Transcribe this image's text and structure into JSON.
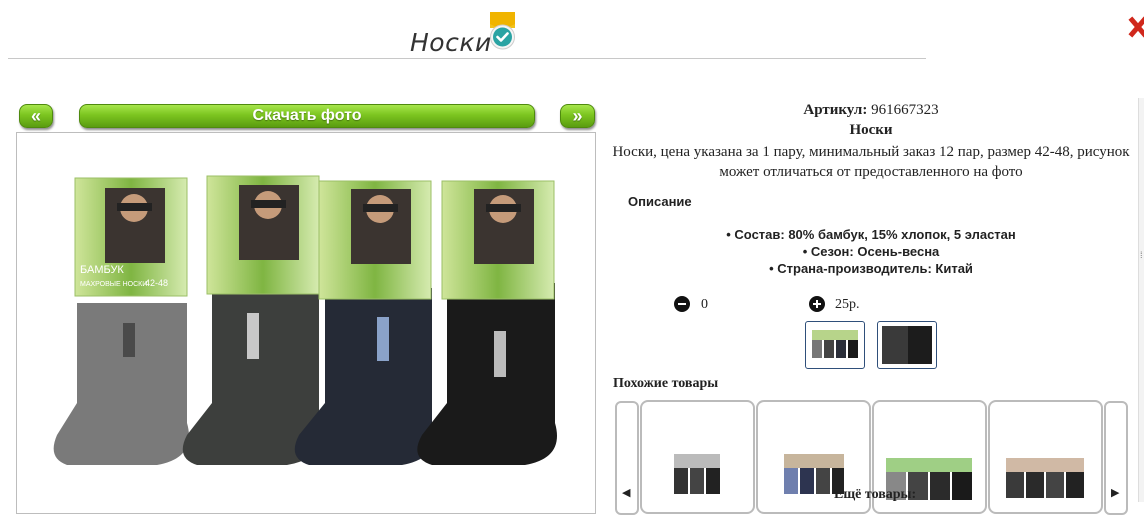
{
  "page": {
    "title": "Носки"
  },
  "photo_nav": {
    "prev_label": "«",
    "download_label": "Скачать фото",
    "next_label": "»"
  },
  "product": {
    "sku_label": "Артикул:",
    "sku_value": "961667323",
    "name": "Носки",
    "description": "Носки, цена указана за 1 пару, минимальный заказ 12 пар, размер 42-48, рисунок может отличаться от предоставленного на фото",
    "description_heading": "Описание",
    "specs": [
      "Состав: 80% бамбук, 15% хлопок, 5 эластан",
      "Сезон: Осень-весна",
      "Страна-производитель: Китай"
    ],
    "quantity": "0",
    "price": "25р.",
    "package_text": {
      "brand": "БАМБУК",
      "subtitle": "МАХРОВЫЕ НОСКИ",
      "size": "42-48"
    }
  },
  "similar": {
    "heading": "Похожие товары",
    "more_label": "Ещё товары:"
  },
  "colors": {
    "accent_green": "#7cc520",
    "thumb_border": "#2f4f7a",
    "close_red": "#d0281c"
  },
  "icons": {
    "verified": "verified-check-icon",
    "minus": "minus-circle-icon",
    "plus": "plus-circle-icon",
    "close": "close-icon"
  }
}
